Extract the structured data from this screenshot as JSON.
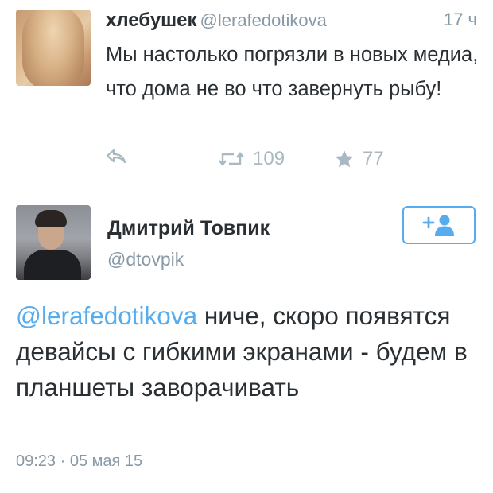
{
  "tweet1": {
    "name": "хлебушек",
    "handle": "@lerafedotikova",
    "time": "17 ч",
    "text": "Мы настолько погрязли в новых медиа, что дома не во что завернуть рыбу!",
    "retweets": "109",
    "favorites": "77"
  },
  "tweet2": {
    "name": "Дмитрий Товпик",
    "handle": "@dtovpik",
    "mention": "@lerafedotikova",
    "text_rest": " ниче, скоро появятся девайсы с гибкими экранами - будем в планшеты заворачивать",
    "timestamp": "09:23 · 05 мая 15"
  },
  "icons": {
    "reply": "reply-icon",
    "retweet": "retweet-icon",
    "favorite": "star-icon",
    "follow": "add-user-icon"
  },
  "colors": {
    "accent": "#55acee",
    "muted": "#8899a6",
    "icon_gray": "#aab8c2",
    "text": "#292f33"
  }
}
